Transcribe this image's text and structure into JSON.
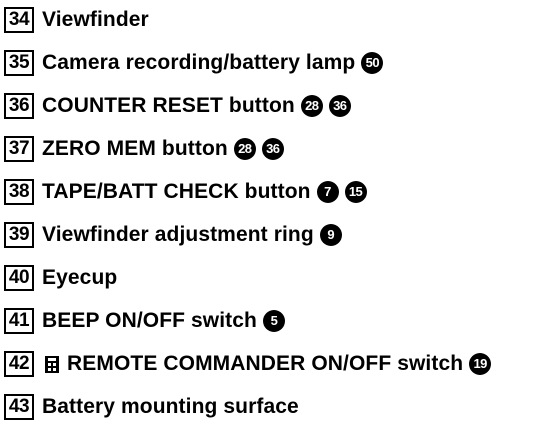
{
  "items": [
    {
      "number": "34",
      "label": "Viewfinder",
      "refs": []
    },
    {
      "number": "35",
      "label": "Camera recording/battery lamp",
      "refs": [
        "50"
      ]
    },
    {
      "number": "36",
      "label": "COUNTER RESET button",
      "refs": [
        "28",
        "36"
      ]
    },
    {
      "number": "37",
      "label": "ZERO MEM button",
      "refs": [
        "28",
        "36"
      ]
    },
    {
      "number": "38",
      "label": "TAPE/BATT CHECK button",
      "refs": [
        "7",
        "15"
      ]
    },
    {
      "number": "39",
      "label": "Viewfinder adjustment ring",
      "refs": [
        "9"
      ]
    },
    {
      "number": "40",
      "label": "Eyecup",
      "refs": []
    },
    {
      "number": "41",
      "label": "BEEP ON/OFF switch",
      "refs": [
        "5"
      ]
    },
    {
      "number": "42",
      "label": "REMOTE COMMANDER ON/OFF switch",
      "refs": [
        "19"
      ],
      "icon": "remote-commander-icon"
    },
    {
      "number": "43",
      "label": "Battery mounting surface",
      "refs": []
    }
  ]
}
